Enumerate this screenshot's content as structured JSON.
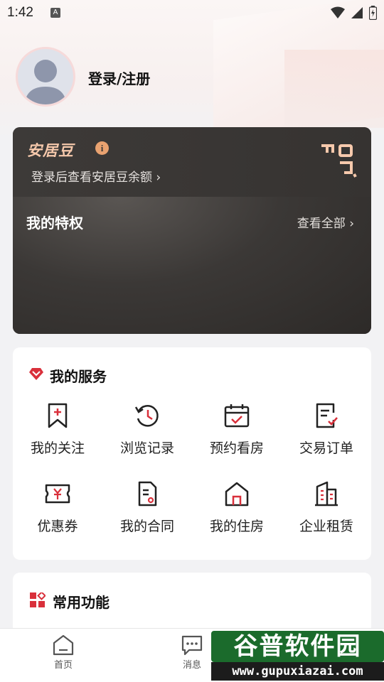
{
  "status_bar": {
    "time": "1:42",
    "notif_letter": "A"
  },
  "profile": {
    "login_label": "登录/注册"
  },
  "bean_card": {
    "title": "安居豆",
    "info_symbol": "i",
    "subtitle": "登录后查看安居豆余额 ›",
    "privileges_title": "我的特权",
    "privileges_view_all": "查看全部 ›"
  },
  "services": {
    "title": "我的服务",
    "items": [
      {
        "label": "我的关注",
        "icon": "bookmark-plus-icon"
      },
      {
        "label": "浏览记录",
        "icon": "history-icon"
      },
      {
        "label": "预约看房",
        "icon": "calendar-check-icon"
      },
      {
        "label": "交易订单",
        "icon": "order-icon"
      },
      {
        "label": "优惠券",
        "icon": "coupon-icon"
      },
      {
        "label": "我的合同",
        "icon": "contract-icon"
      },
      {
        "label": "我的住房",
        "icon": "house-icon"
      },
      {
        "label": "企业租赁",
        "icon": "building-icon"
      }
    ]
  },
  "common": {
    "title": "常用功能"
  },
  "bottom_nav": {
    "items": [
      {
        "label": "首页",
        "icon": "home-icon"
      },
      {
        "label": "消息",
        "icon": "message-icon"
      }
    ]
  },
  "watermark": {
    "title": "谷普软件园",
    "url": "www.gupuxiazai.com"
  },
  "colors": {
    "accent": "#d9303b",
    "bean_gold": "#f6c9ac",
    "dark_card": "#3a3836"
  }
}
